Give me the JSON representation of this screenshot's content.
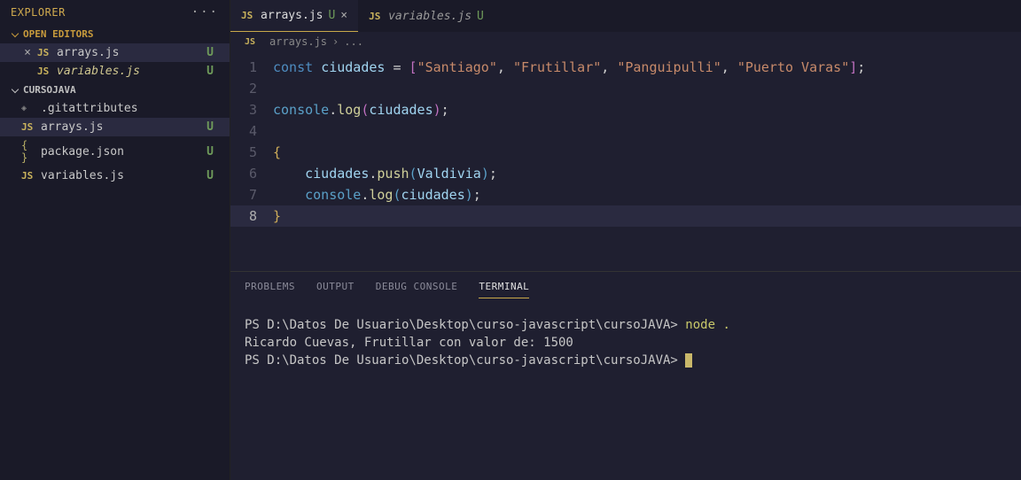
{
  "sidebar": {
    "title": "EXPLORER",
    "openEditors": "OPEN EDITORS",
    "folder": "CURSOJAVA",
    "editors": [
      {
        "name": "arrays.js",
        "badge": "U",
        "sel": true,
        "close": true,
        "italic": false
      },
      {
        "name": "variables.js",
        "badge": "U",
        "sel": false,
        "close": false,
        "italic": true
      }
    ],
    "files": [
      {
        "name": ".gitattributes",
        "type": "diamond",
        "badge": ""
      },
      {
        "name": "arrays.js",
        "type": "js",
        "badge": "U",
        "sel": true
      },
      {
        "name": "package.json",
        "type": "curly",
        "badge": "U"
      },
      {
        "name": "variables.js",
        "type": "js",
        "badge": "U"
      }
    ]
  },
  "tabs": [
    {
      "name": "arrays.js",
      "badge": "U",
      "active": true,
      "italic": false,
      "close": "×"
    },
    {
      "name": "variables.js",
      "badge": "U",
      "active": false,
      "italic": true,
      "close": ""
    }
  ],
  "crumbs": {
    "file": "arrays.js",
    "sep": "›",
    "rest": "..."
  },
  "code": [
    {
      "n": "1",
      "tokens": [
        {
          "t": "const ",
          "c": "c-kw"
        },
        {
          "t": "ciudades",
          "c": "c-var"
        },
        {
          "t": " = ",
          "c": "c-op"
        },
        {
          "t": "[",
          "c": "c-br-p"
        },
        {
          "t": "\"Santiago\"",
          "c": "c-str"
        },
        {
          "t": ", ",
          "c": "c-op"
        },
        {
          "t": "\"Frutillar\"",
          "c": "c-str"
        },
        {
          "t": ", ",
          "c": "c-op"
        },
        {
          "t": "\"Panguipulli\"",
          "c": "c-str"
        },
        {
          "t": ", ",
          "c": "c-op"
        },
        {
          "t": "\"Puerto Varas\"",
          "c": "c-str"
        },
        {
          "t": "]",
          "c": "c-br-p"
        },
        {
          "t": ";",
          "c": "c-op"
        }
      ]
    },
    {
      "n": "2",
      "tokens": []
    },
    {
      "n": "3",
      "tokens": [
        {
          "t": "console",
          "c": "c-obj"
        },
        {
          "t": ".",
          "c": "c-op"
        },
        {
          "t": "log",
          "c": "c-fn"
        },
        {
          "t": "(",
          "c": "c-br-p"
        },
        {
          "t": "ciudades",
          "c": "c-id"
        },
        {
          "t": ")",
          "c": "c-br-p"
        },
        {
          "t": ";",
          "c": "c-op"
        }
      ]
    },
    {
      "n": "4",
      "tokens": []
    },
    {
      "n": "5",
      "tokens": [
        {
          "t": "{",
          "c": "c-br"
        }
      ]
    },
    {
      "n": "6",
      "tokens": [
        {
          "t": "    ",
          "c": ""
        },
        {
          "t": "ciudades",
          "c": "c-id"
        },
        {
          "t": ".",
          "c": "c-op"
        },
        {
          "t": "push",
          "c": "c-fn"
        },
        {
          "t": "(",
          "c": "c-br-b"
        },
        {
          "t": "Valdivia",
          "c": "c-id"
        },
        {
          "t": ")",
          "c": "c-br-b"
        },
        {
          "t": ";",
          "c": "c-op"
        }
      ],
      "indent": true
    },
    {
      "n": "7",
      "tokens": [
        {
          "t": "    ",
          "c": ""
        },
        {
          "t": "console",
          "c": "c-obj"
        },
        {
          "t": ".",
          "c": "c-op"
        },
        {
          "t": "log",
          "c": "c-fn"
        },
        {
          "t": "(",
          "c": "c-br-b"
        },
        {
          "t": "ciudades",
          "c": "c-id"
        },
        {
          "t": ")",
          "c": "c-br-b"
        },
        {
          "t": ";",
          "c": "c-op"
        }
      ],
      "indent": true
    },
    {
      "n": "8",
      "tokens": [
        {
          "t": "}",
          "c": "c-br"
        }
      ],
      "hl": true
    }
  ],
  "panel": {
    "tabs": [
      "PROBLEMS",
      "OUTPUT",
      "DEBUG CONSOLE",
      "TERMINAL"
    ],
    "active": 3,
    "terminal": {
      "prompt1": "PS D:\\Datos De Usuario\\Desktop\\curso-javascript\\cursoJAVA> ",
      "cmd": "node .",
      "out": "Ricardo Cuevas, Frutillar con valor de: 1500",
      "prompt2": "PS D:\\Datos De Usuario\\Desktop\\curso-javascript\\cursoJAVA> "
    }
  }
}
